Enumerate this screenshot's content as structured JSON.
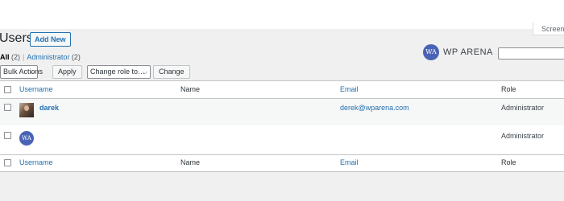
{
  "header": {
    "title": "Users",
    "add_new_label": "Add New",
    "screen_options_label": "Screen O"
  },
  "filters": {
    "all_label": "All",
    "all_count": "(2)",
    "separator": "|",
    "admin_label": "Administrator",
    "admin_count": "(2)"
  },
  "branding": {
    "logo_mark": "WA",
    "logo_text": "WP ARENA"
  },
  "search": {
    "value": ""
  },
  "bulk_actions": {
    "select_value": "Bulk Actions",
    "apply_label": "Apply",
    "role_select_value": "Change role to…",
    "change_label": "Change"
  },
  "table": {
    "columns": [
      "Username",
      "Name",
      "Email",
      "Role"
    ],
    "rows": [
      {
        "username": "darek",
        "name": "",
        "email": "derek@wparena.com",
        "role": "Administrator",
        "avatar": "photo"
      },
      {
        "username": "",
        "name": "",
        "email": "",
        "role": "Administrator",
        "avatar": "WA"
      }
    ]
  },
  "colors": {
    "accent": "#2271b1",
    "brand": "#4a63b5",
    "admin_bg": "#f0f0f1"
  }
}
